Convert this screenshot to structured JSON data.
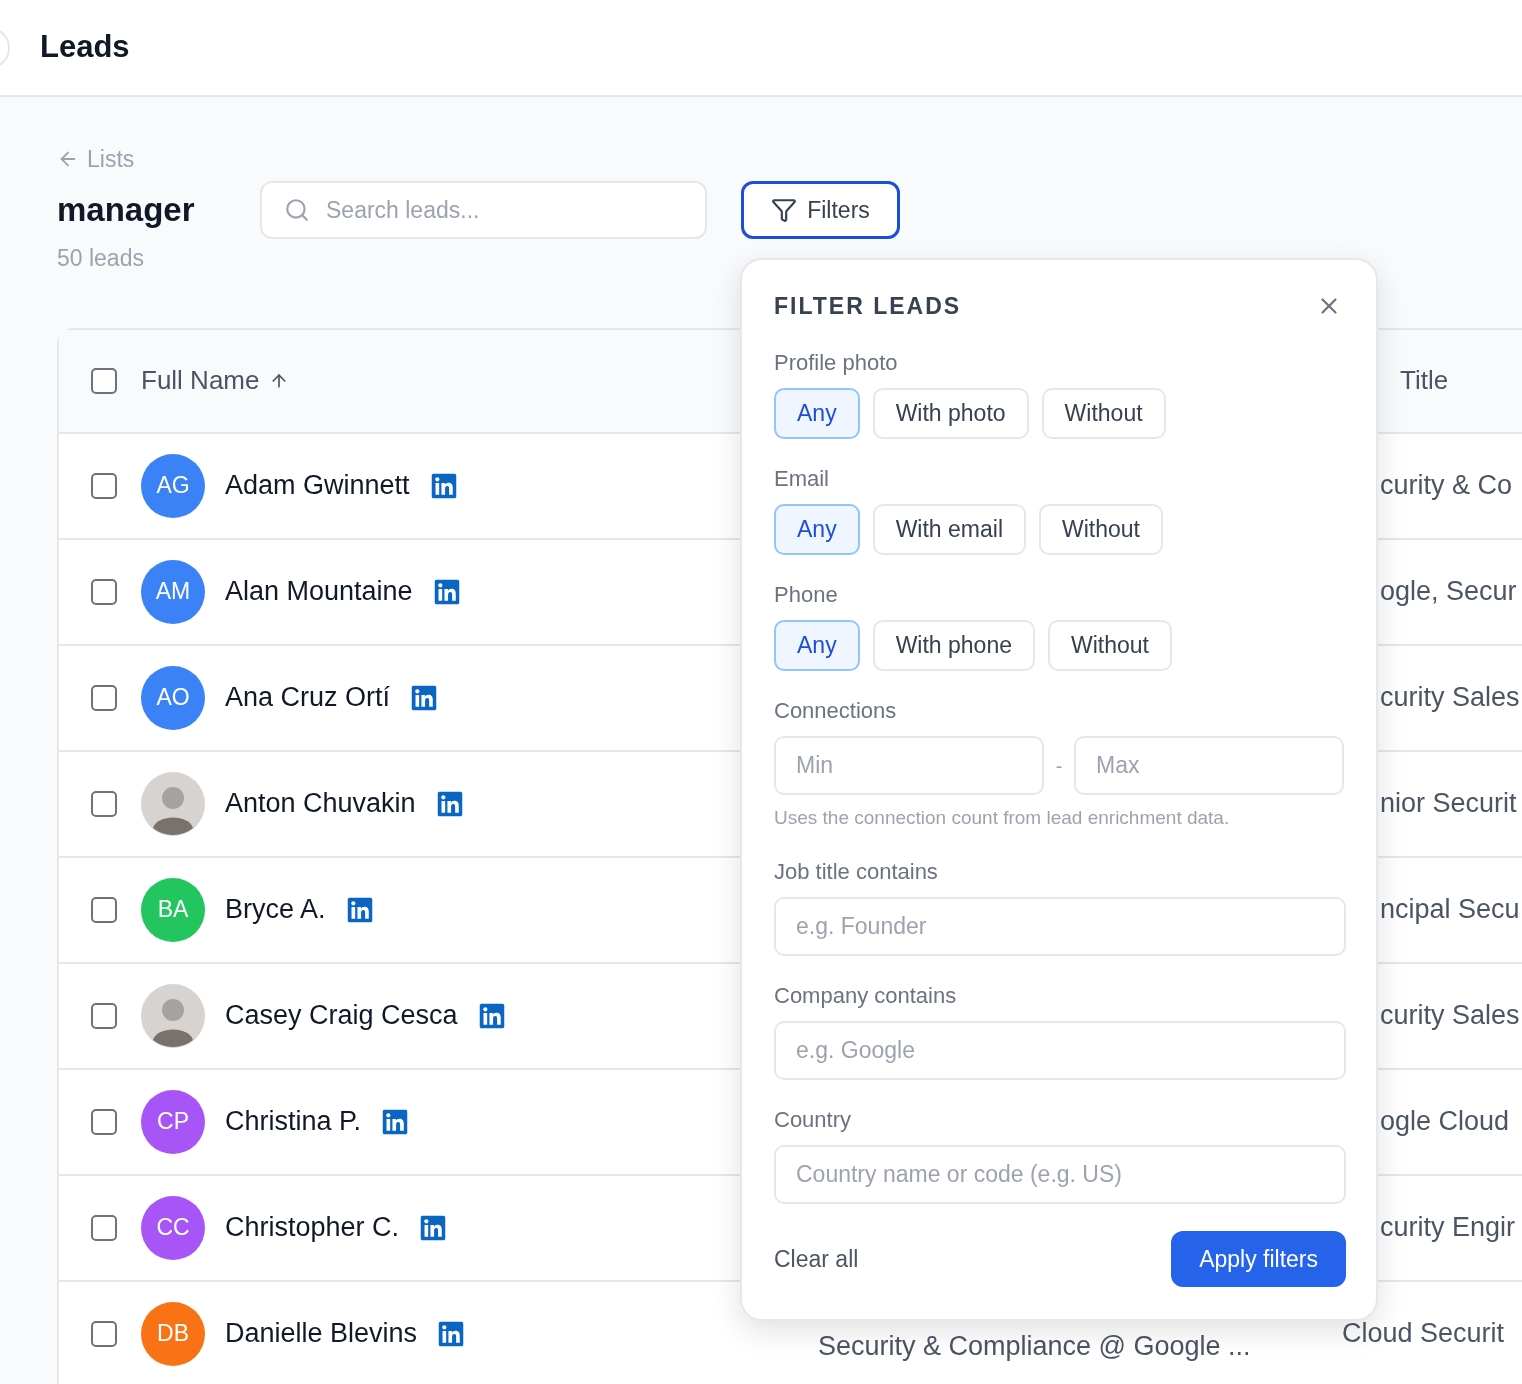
{
  "header": {
    "title": "Leads"
  },
  "list": {
    "back_link": "Lists",
    "name": "manager",
    "count": "50 leads"
  },
  "search": {
    "placeholder": "Search leads..."
  },
  "filters_button": {
    "label": "Filters",
    "active": true
  },
  "table": {
    "columns": [
      {
        "label": "Full Name",
        "sorted": true,
        "checked": false
      },
      {
        "label": "Title"
      }
    ],
    "rows": [
      {
        "initials": "AG",
        "kind": "initials",
        "color": "#3b82f6",
        "name": "Adam Gwinnett",
        "checked": false,
        "title": "curity & Co"
      },
      {
        "initials": "AM",
        "kind": "initials",
        "color": "#3b82f6",
        "name": "Alan Mountaine",
        "checked": false,
        "title": "ogle, Secur"
      },
      {
        "initials": "AO",
        "kind": "initials",
        "color": "#3b82f6",
        "name": "Ana Cruz Ortí",
        "checked": false,
        "title": "curity Sales"
      },
      {
        "kind": "photo",
        "name": "Anton Chuvakin",
        "checked": false,
        "title": "nior Securit"
      },
      {
        "initials": "BA",
        "kind": "initials",
        "color": "#22c55e",
        "name": "Bryce A.",
        "checked": false,
        "title": "ncipal Secu"
      },
      {
        "kind": "photo",
        "name": "Casey Craig Cesca",
        "checked": false,
        "title": "curity Sales"
      },
      {
        "initials": "CP",
        "kind": "initials",
        "color": "#a855f7",
        "name": "Christina P.",
        "checked": false,
        "title": "ogle Cloud"
      },
      {
        "initials": "CC",
        "kind": "initials",
        "color": "#a855f7",
        "name": "Christopher C.",
        "checked": false,
        "title": "curity Engir"
      },
      {
        "initials": "DB",
        "kind": "initials",
        "color": "#f97316",
        "name": "Danielle Blevins",
        "checked": false,
        "company": "Security & Compliance @ Google ...",
        "title": "Cloud Securit"
      }
    ]
  },
  "filter_panel": {
    "title": "FILTER LEADS",
    "sections": [
      {
        "kind": "choice",
        "label": "Profile photo",
        "options": [
          {
            "label": "Any",
            "selected": true
          },
          {
            "label": "With photo",
            "selected": false
          },
          {
            "label": "Without",
            "selected": false
          }
        ]
      },
      {
        "kind": "choice",
        "label": "Email",
        "options": [
          {
            "label": "Any",
            "selected": true
          },
          {
            "label": "With email",
            "selected": false
          },
          {
            "label": "Without",
            "selected": false
          }
        ]
      },
      {
        "kind": "choice",
        "label": "Phone",
        "options": [
          {
            "label": "Any",
            "selected": true
          },
          {
            "label": "With phone",
            "selected": false
          },
          {
            "label": "Without",
            "selected": false
          }
        ]
      },
      {
        "kind": "range",
        "label": "Connections",
        "min_placeholder": "Min",
        "separator": "-",
        "max_placeholder": "Max",
        "hint": "Uses the connection count from lead enrichment data."
      },
      {
        "kind": "text",
        "label": "Job title contains",
        "placeholder": "e.g. Founder"
      },
      {
        "kind": "text",
        "label": "Company contains",
        "placeholder": "e.g. Google"
      },
      {
        "kind": "text",
        "label": "Country",
        "placeholder": "Country name or code (e.g. US)"
      }
    ],
    "clear": "Clear all",
    "apply": "Apply filters"
  }
}
